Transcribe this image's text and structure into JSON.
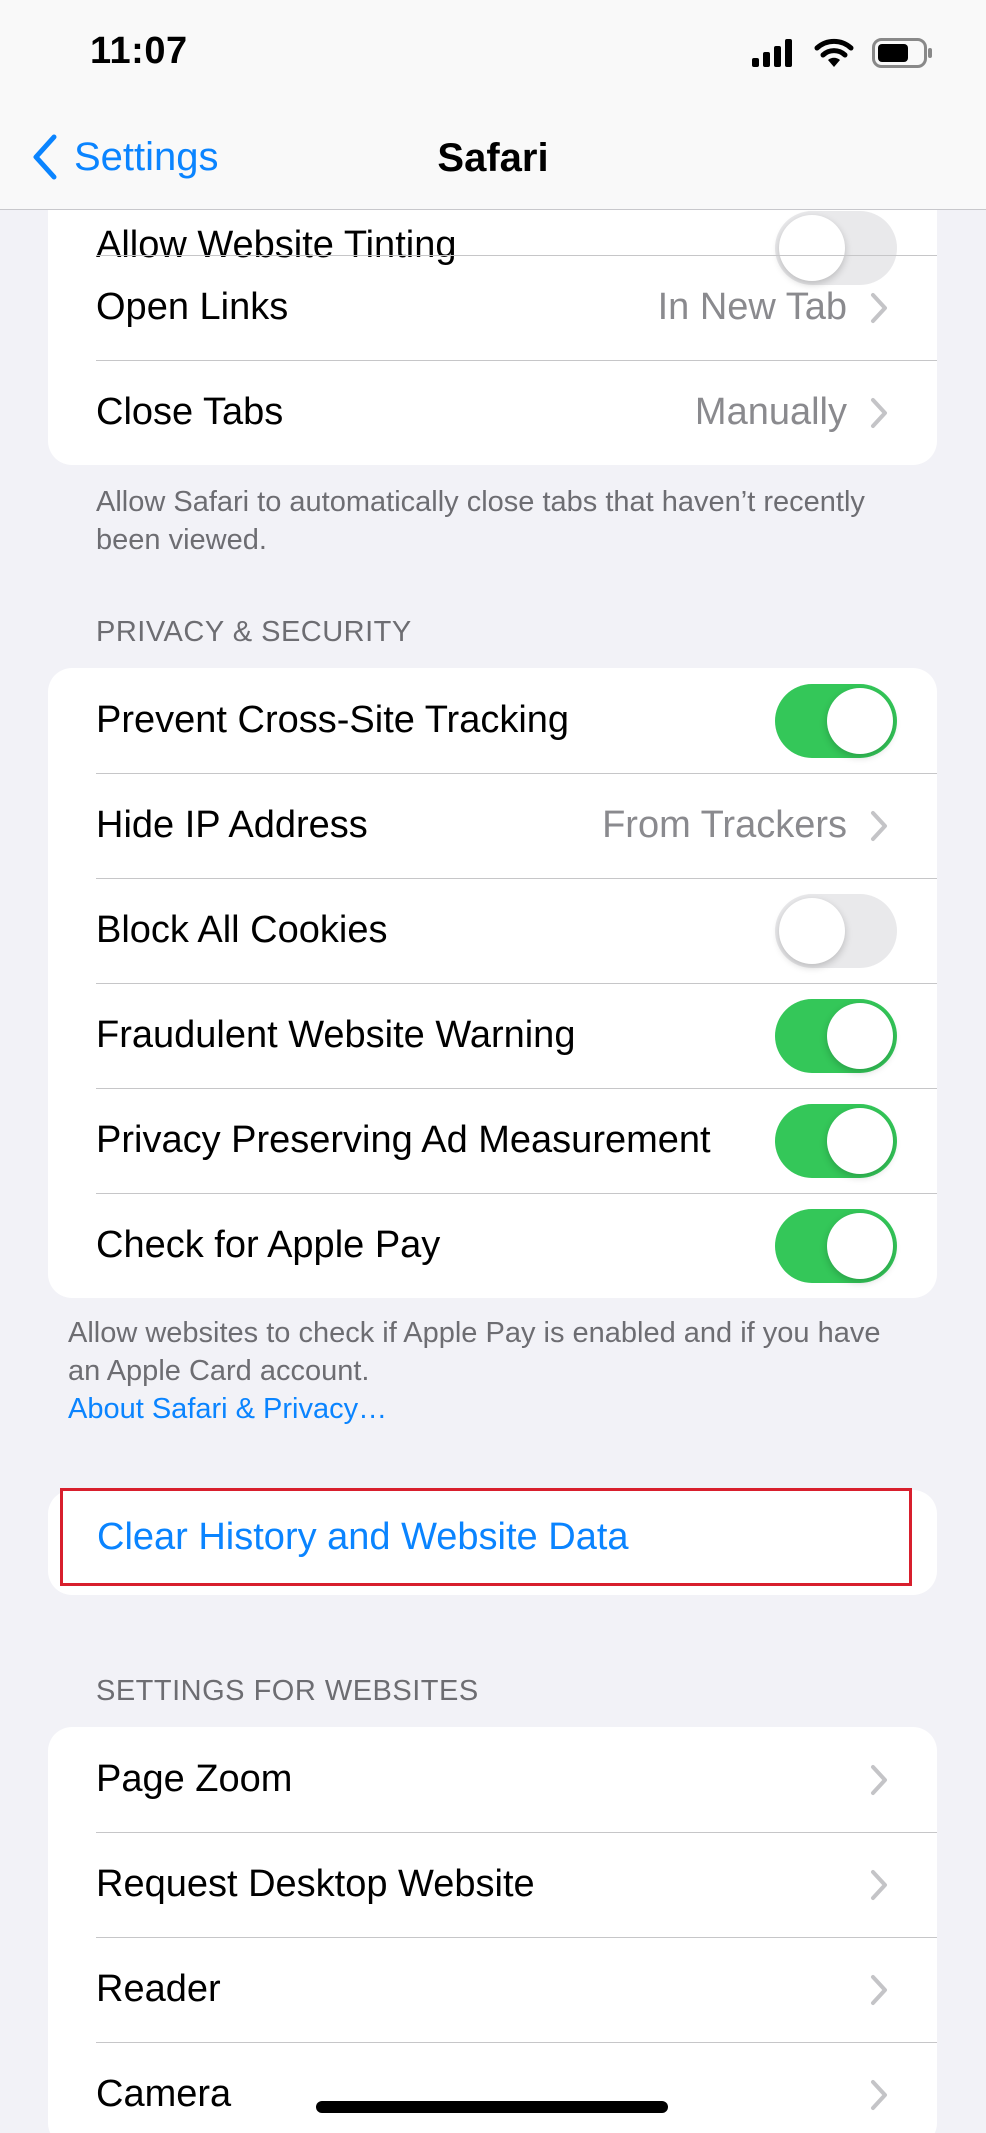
{
  "status_bar": {
    "time": "11:07"
  },
  "nav": {
    "back_label": "Settings",
    "title": "Safari"
  },
  "tabs_group": {
    "partial_row": {
      "label": "Allow Website Tinting",
      "toggle": "off"
    },
    "rows": [
      {
        "label": "Open Links",
        "value": "In New Tab"
      },
      {
        "label": "Close Tabs",
        "value": "Manually"
      }
    ],
    "footer": "Allow Safari to automatically close tabs that haven’t recently been viewed."
  },
  "privacy": {
    "header": "PRIVACY & SECURITY",
    "rows": [
      {
        "label": "Prevent Cross-Site Tracking",
        "toggle": "on"
      },
      {
        "label": "Hide IP Address",
        "value": "From Trackers"
      },
      {
        "label": "Block All Cookies",
        "toggle": "off"
      },
      {
        "label": "Fraudulent Website Warning",
        "toggle": "on"
      },
      {
        "label": "Privacy Preserving Ad Measurement",
        "toggle": "on"
      },
      {
        "label": "Check for Apple Pay",
        "toggle": "on"
      }
    ],
    "footer": "Allow websites to check if Apple Pay is enabled and if you have an Apple Card account.",
    "footer_link": "About Safari & Privacy…"
  },
  "clear": {
    "label": "Clear History and Website Data"
  },
  "websites": {
    "header": "SETTINGS FOR WEBSITES",
    "rows": [
      {
        "label": "Page Zoom"
      },
      {
        "label": "Request Desktop Website"
      },
      {
        "label": "Reader"
      },
      {
        "label": "Camera"
      }
    ]
  },
  "colors": {
    "accent": "#0a84ff",
    "toggle_on": "#34c759",
    "highlight": "#d81f2d"
  }
}
